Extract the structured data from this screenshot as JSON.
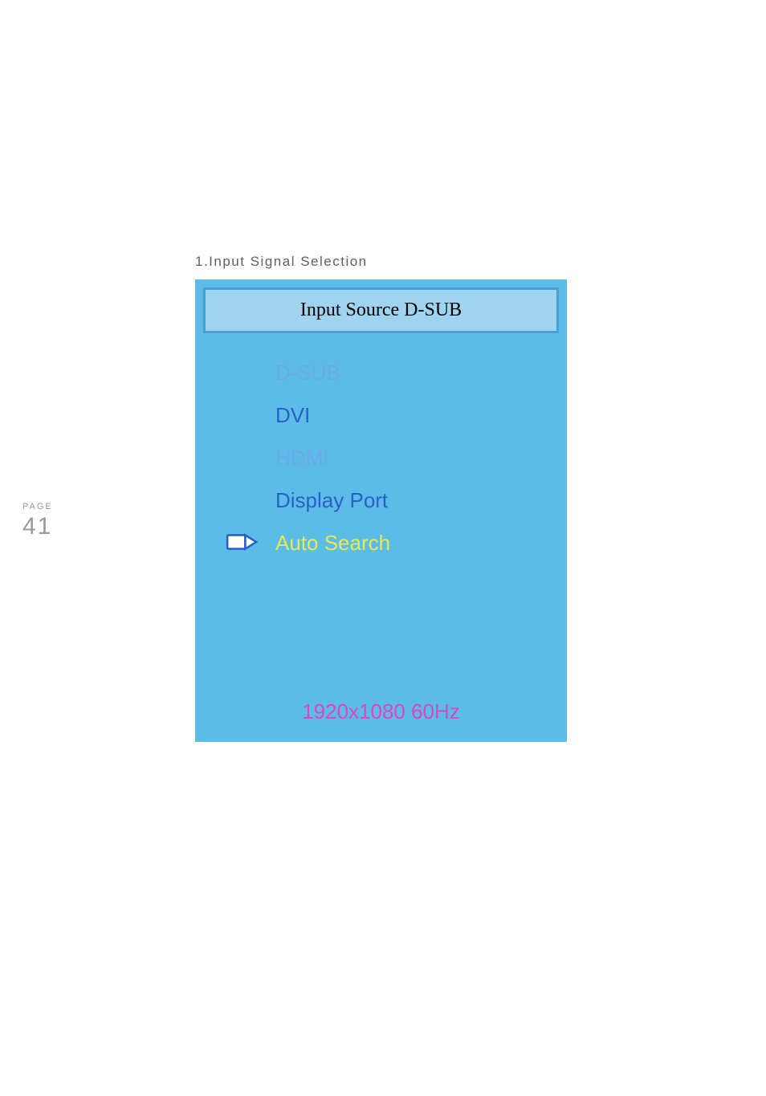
{
  "page": {
    "label": "PAGE",
    "number": "41"
  },
  "heading": "1.Input Signal Selection",
  "osd": {
    "header_prefix": "Input Source ",
    "header_value": "D-SUB",
    "options": {
      "dsub": "D-SUB",
      "dvi": "DVI",
      "hdmi": "HDMI",
      "displayport": "Display Port",
      "autosearch": "Auto Search"
    },
    "resolution": "1920x1080 60Hz"
  }
}
